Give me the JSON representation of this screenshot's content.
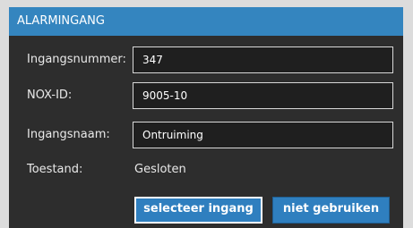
{
  "dialog": {
    "title": "ALARMINGANG"
  },
  "fields": {
    "ingangsnummer": {
      "label": "Ingangsnummer:",
      "value": "347"
    },
    "nox_id": {
      "label": "NOX-ID:",
      "value": "9005-10"
    },
    "ingangsnaam": {
      "label": "Ingangsnaam:",
      "value": "Ontruiming"
    },
    "toestand": {
      "label": "Toestand:",
      "value": "Gesloten"
    }
  },
  "buttons": {
    "select_label": "selecteer ingang",
    "disable_label": "niet gebruiken"
  },
  "colors": {
    "titlebar": "#3485bf",
    "panel": "#2d2d2d",
    "button": "#2f7fbf"
  }
}
